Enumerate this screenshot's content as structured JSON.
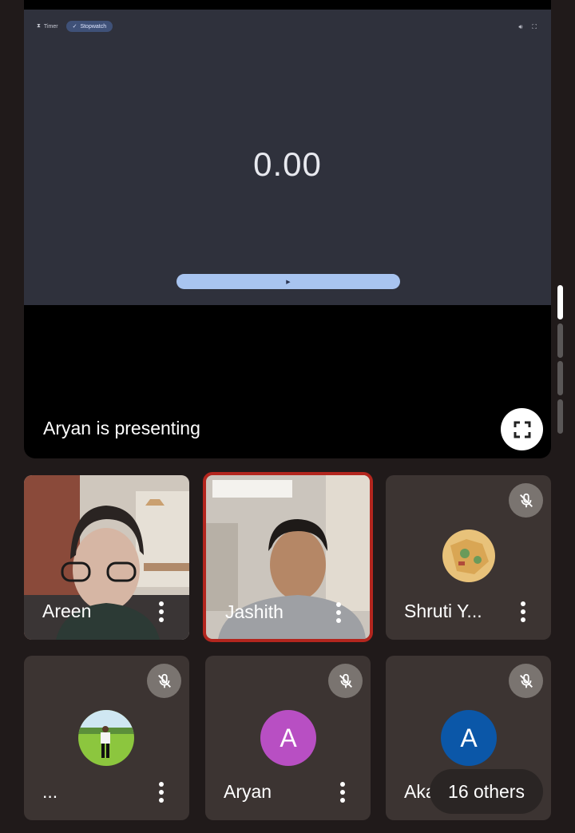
{
  "presentation": {
    "tabs": {
      "timer": "Timer",
      "stopwatch": "Stopwatch"
    },
    "stopwatch_value": "0.00",
    "label": "Aryan is presenting"
  },
  "participants": [
    {
      "name": "Areen",
      "type": "video"
    },
    {
      "name": "Jashith",
      "type": "video",
      "speaking": true
    },
    {
      "name": "Shruti Y...",
      "type": "avatar-image",
      "muted": true
    },
    {
      "name": "...",
      "type": "avatar-image",
      "muted": true
    },
    {
      "name": "Aryan",
      "type": "avatar-letter",
      "initial": "A",
      "color": "#b84fc3",
      "muted": true
    },
    {
      "name": "Aka",
      "type": "avatar-letter",
      "initial": "A",
      "color": "#0b57a8",
      "muted": true
    }
  ],
  "others_label": "16 others",
  "colors": {
    "background": "#201a1a",
    "speaking_border": "#b3261e",
    "play_bar": "#a8c4f0"
  }
}
